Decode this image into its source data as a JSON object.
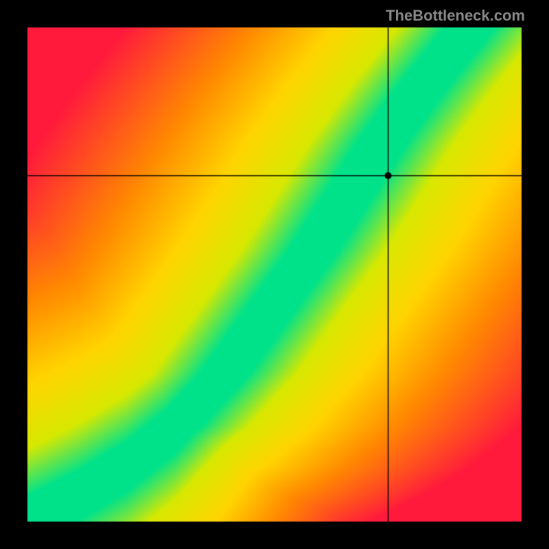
{
  "watermark": "TheBottleneck.com",
  "chart_data": {
    "type": "heatmap",
    "title": "",
    "xlabel": "",
    "ylabel": "",
    "xlim": [
      0,
      1
    ],
    "ylim": [
      0,
      1
    ],
    "crosshair": {
      "x": 0.73,
      "y": 0.7
    },
    "curve_points": [
      {
        "x": 0.0,
        "y": 0.0
      },
      {
        "x": 0.1,
        "y": 0.05
      },
      {
        "x": 0.2,
        "y": 0.11
      },
      {
        "x": 0.3,
        "y": 0.19
      },
      {
        "x": 0.4,
        "y": 0.3
      },
      {
        "x": 0.5,
        "y": 0.44
      },
      {
        "x": 0.58,
        "y": 0.55
      },
      {
        "x": 0.65,
        "y": 0.66
      },
      {
        "x": 0.72,
        "y": 0.77
      },
      {
        "x": 0.8,
        "y": 0.88
      },
      {
        "x": 0.88,
        "y": 0.98
      }
    ],
    "colorscale": [
      {
        "stop": 0.0,
        "color": "#00e28a"
      },
      {
        "stop": 0.15,
        "color": "#d8e800"
      },
      {
        "stop": 0.35,
        "color": "#ffd400"
      },
      {
        "stop": 0.6,
        "color": "#ff8a00"
      },
      {
        "stop": 1.0,
        "color": "#ff1a3c"
      }
    ],
    "band_width": 0.05
  }
}
